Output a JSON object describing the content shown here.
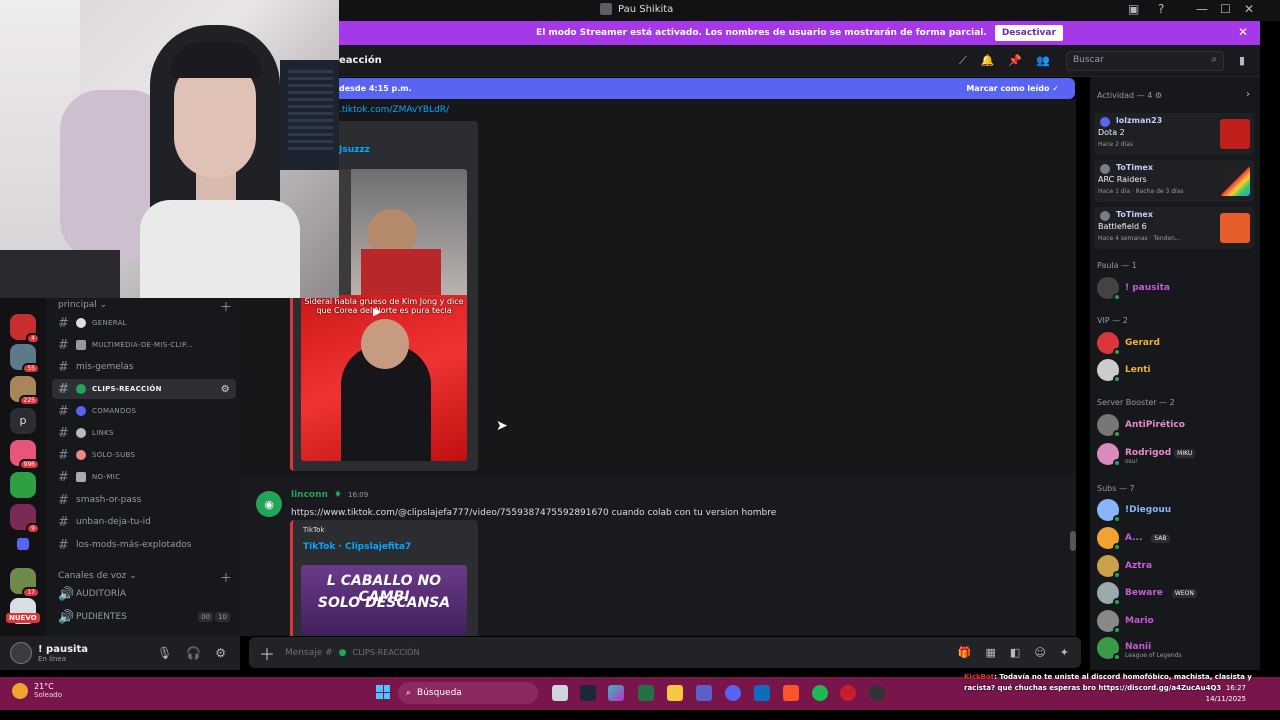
{
  "window": {
    "title": "Pau Shikita"
  },
  "banner": {
    "text": "El modo Streamer está activado. Los nombres de usuario se mostrarán de forma parcial.",
    "button": "Desactivar",
    "close": "✕"
  },
  "header": {
    "channel_partial": "eacción",
    "search_placeholder": "Buscar"
  },
  "newbar": {
    "left": "desde 4:15 p.m.",
    "right": "Marcar como leído"
  },
  "server_badges": [
    "4",
    "55",
    "225",
    "996",
    "9",
    "17"
  ],
  "server_letter": "p",
  "nuevo": "NUEVO",
  "channels": {
    "category_main": "principal",
    "items": [
      {
        "label": "GENERAL",
        "small": true
      },
      {
        "label": "MULTIMEDIA-DE-MIS-CLIP...",
        "small": true
      },
      {
        "label": "mis-gemelas",
        "small": false
      },
      {
        "label": "CLIPS-REACCIÓN",
        "small": true,
        "active": true
      },
      {
        "label": "COMANDOS",
        "small": true
      },
      {
        "label": "LINKS",
        "small": true
      },
      {
        "label": "SOLO-SUBS",
        "small": true
      },
      {
        "label": "NO-MIC",
        "small": true
      },
      {
        "label": "smash-or-pass",
        "small": false
      },
      {
        "label": "unban-deja-tu-id",
        "small": false
      },
      {
        "label": "los-mods-más-explotados",
        "small": false
      }
    ],
    "category_voice": "Canales de voz",
    "voice": [
      {
        "label": "AUDITORÍA"
      },
      {
        "label": "PUDIENTES",
        "count_a": "00",
        "count_b": "10"
      }
    ]
  },
  "user": {
    "name": "! pausita",
    "status": "En línea"
  },
  "chat": {
    "msg1": {
      "link": ".tiktok.com/ZMAvYBLdR/",
      "embed_title": "Jsuzzz",
      "caption": "Sideral habla grueso de Kim Jong y dice que Corea del Norte es pura tecla"
    },
    "msg2": {
      "author": "linconn",
      "time": "16:09",
      "link": "https://www.tiktok.com/@clipslajefa777/video/7559387475592891670",
      "text": " cuando colab con tu version hombre",
      "provider": "TikTok",
      "embed_title": "TikTok · Clipslajefita7",
      "thumb_text_1": "L CABALLO NO CAMBI",
      "thumb_text_2": "SOLO DESCANSA"
    }
  },
  "composer": {
    "placeholder": "Mensaje #",
    "channel": "CLIPS-REACCIÓN"
  },
  "members": {
    "activity_header": "Actividad — 4",
    "activities": [
      {
        "user": "lolzman23",
        "game": "Dota 2",
        "detail": "Hace 2 días",
        "color": "#c0201c"
      },
      {
        "user": "ToTimex",
        "game": "ARC Raiders",
        "detail": "Hace 1 día · Racha de 3 días",
        "color": "#1a1a1a"
      },
      {
        "user": "ToTimex",
        "game": "Battlefield 6",
        "detail": "Hace 4 semanas · Tenden...",
        "color": "#e65c2a"
      }
    ],
    "sections": [
      {
        "title": "Paula — 1",
        "members": [
          {
            "name": "! pausita",
            "color": "#c65bd6",
            "sub": ""
          }
        ]
      },
      {
        "title": "VIP — 2",
        "members": [
          {
            "name": "Gerard",
            "color": "#f0b232",
            "sub": ""
          },
          {
            "name": "Lenti",
            "color": "#f0b232",
            "sub": ""
          }
        ]
      },
      {
        "title": "Server Booster — 2",
        "members": [
          {
            "name": "AntiPirético",
            "color": "#e88ac7",
            "sub": ""
          },
          {
            "name": "Rodrigod",
            "color": "#e88ac7",
            "sub": "osu!",
            "tag": "MIKU"
          }
        ]
      },
      {
        "title": "Subs — 7",
        "members": [
          {
            "name": "!Diegouu",
            "color": "#8ab4ff",
            "sub": ""
          },
          {
            "name": "A...",
            "color": "#c65bd6",
            "sub": "",
            "tag": "SAB"
          },
          {
            "name": "Aztra",
            "color": "#c65bd6",
            "sub": ""
          },
          {
            "name": "Beware",
            "color": "#c65bd6",
            "sub": "",
            "tag": "WEON"
          },
          {
            "name": "Mario",
            "color": "#c65bd6",
            "sub": ""
          },
          {
            "name": "Nanii",
            "color": "#c65bd6",
            "sub": "League of Legends"
          }
        ]
      }
    ]
  },
  "taskbar": {
    "temp": "21°C",
    "cond": "Soleado",
    "search": "Búsqueda",
    "time": "16:27",
    "date": "14/11/2025"
  },
  "overlay_chat": {
    "bot": "KickBot",
    "text": ": Todavía no te uniste al discord homofóbico, machista, clasista y racista? qué chuchas esperas bro https://discord.gg/a4ZucAu4Q3"
  }
}
